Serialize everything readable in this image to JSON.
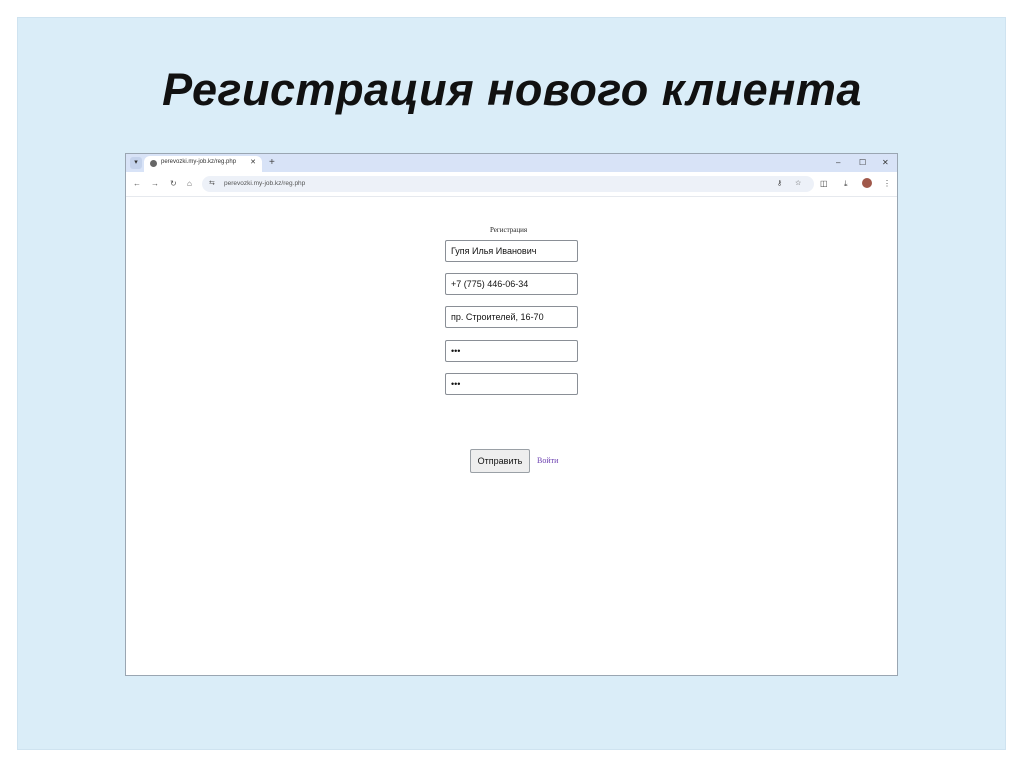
{
  "slide": {
    "title": "Регистрация нового клиента"
  },
  "browser": {
    "tab_title": "perevozki.my-job.kz/reg.php",
    "url": "perevozki.my-job.kz/reg.php",
    "icons": {
      "tab_list": "chevron-down-icon",
      "favicon": "globe-icon",
      "tab_close": "close-icon",
      "new_tab": "plus-icon",
      "minimize": "minimize-icon",
      "maximize": "maximize-icon",
      "close_window": "close-icon",
      "back": "back-arrow-icon",
      "forward": "forward-arrow-icon",
      "reload": "reload-icon",
      "home": "home-icon",
      "site_info": "tune-icon",
      "password_key": "key-icon",
      "bookmark": "star-icon",
      "extensions": "puzzle-icon",
      "downloads": "download-icon",
      "profile": "avatar",
      "menu": "kebab-menu-icon"
    }
  },
  "form": {
    "heading": "Регистрация",
    "fields": {
      "name": "Гупя Илья Иванович",
      "phone": "+7 (775) 446-06-34",
      "address": "пр. Строителей, 16-70",
      "password": "•••",
      "password_confirm": "•••"
    },
    "submit_label": "Отправить",
    "login_link": "Войти"
  },
  "colors": {
    "slide_background": "#daedf8",
    "tabbar": "#d8e3f7",
    "link": "#6b3fb0"
  }
}
